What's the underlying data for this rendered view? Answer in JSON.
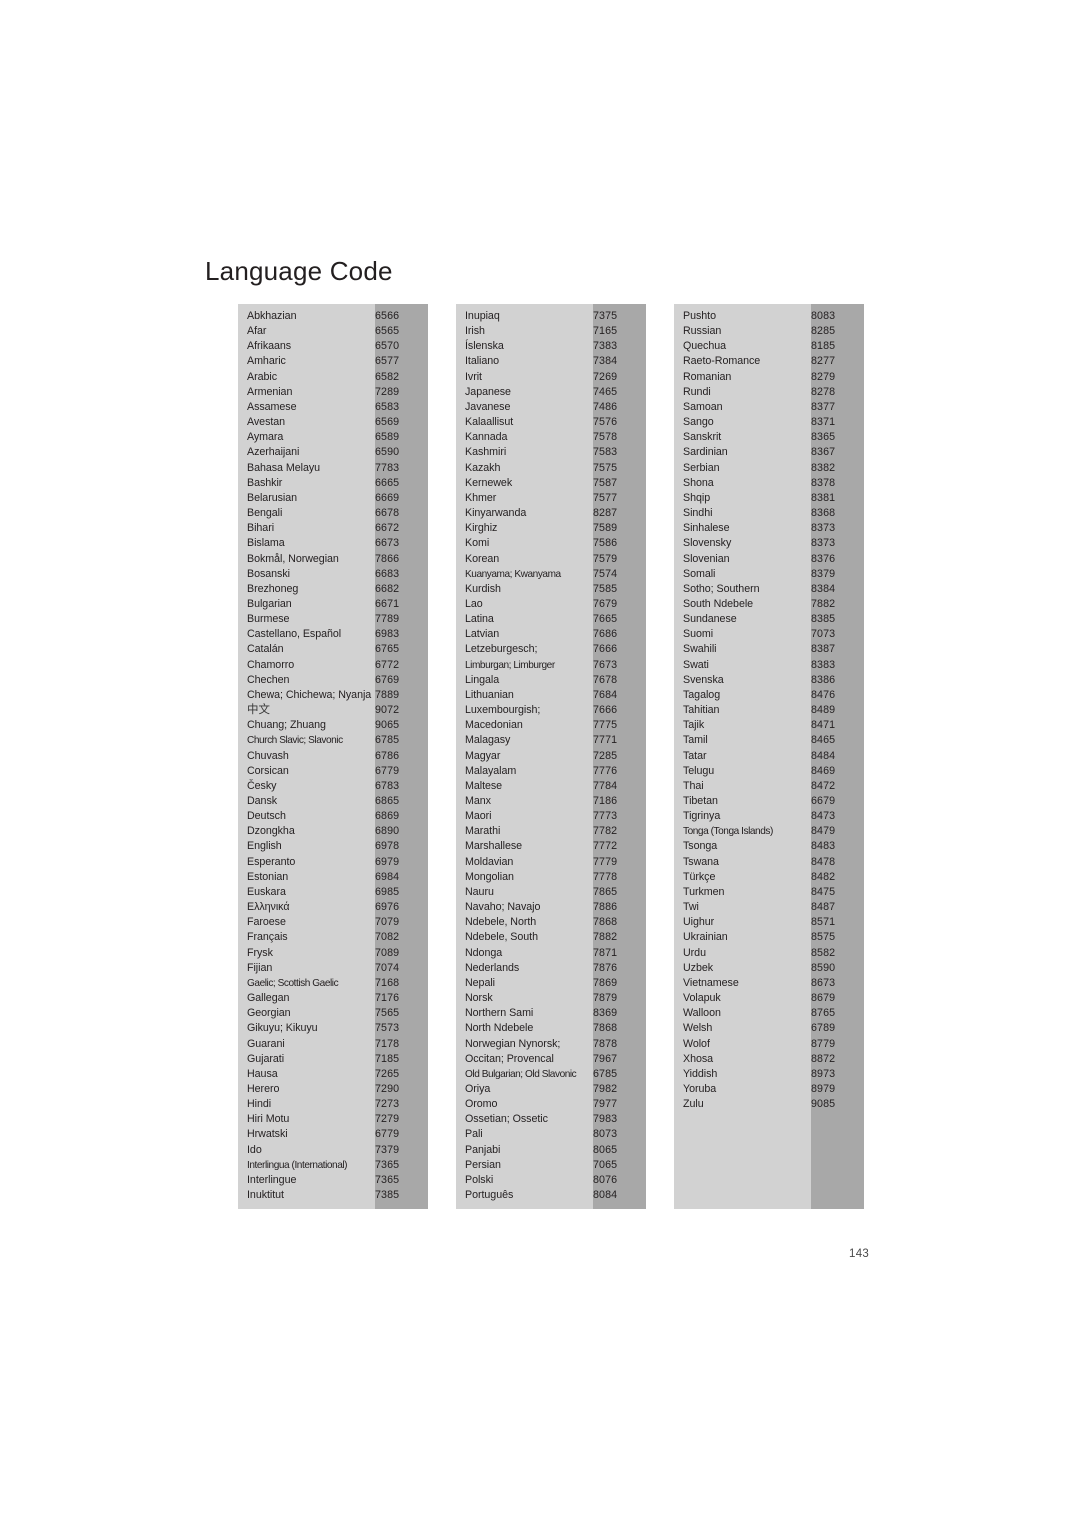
{
  "page": {
    "title": "Language Code",
    "page_number": "143",
    "colors": {
      "name_column_bg": "#d2d2d2",
      "code_column_bg": "#a8a8a8",
      "text": "#231f20",
      "page_bg": "#ffffff"
    }
  },
  "columns": [
    {
      "id": "column-1",
      "rows": [
        {
          "language": "Abkhazian",
          "code": "6566"
        },
        {
          "language": "Afar",
          "code": "6565"
        },
        {
          "language": "Afrikaans",
          "code": "6570"
        },
        {
          "language": "Amharic",
          "code": "6577"
        },
        {
          "language": "Arabic",
          "code": "6582"
        },
        {
          "language": "Armenian",
          "code": "7289"
        },
        {
          "language": "Assamese",
          "code": "6583"
        },
        {
          "language": "Avestan",
          "code": "6569"
        },
        {
          "language": "Aymara",
          "code": "6589"
        },
        {
          "language": "Azerhaijani",
          "code": "6590"
        },
        {
          "language": "Bahasa Melayu",
          "code": "7783"
        },
        {
          "language": "Bashkir",
          "code": "6665"
        },
        {
          "language": "Belarusian",
          "code": "6669"
        },
        {
          "language": "Bengali",
          "code": "6678"
        },
        {
          "language": "Bihari",
          "code": "6672"
        },
        {
          "language": "Bislama",
          "code": "6673"
        },
        {
          "language": "Bokmål, Norwegian",
          "code": "7866"
        },
        {
          "language": "Bosanski",
          "code": "6683"
        },
        {
          "language": "Brezhoneg",
          "code": "6682"
        },
        {
          "language": "Bulgarian",
          "code": "6671"
        },
        {
          "language": "Burmese",
          "code": "7789"
        },
        {
          "language": "Castellano, Español",
          "code": "6983"
        },
        {
          "language": "Catalán",
          "code": "6765"
        },
        {
          "language": "Chamorro",
          "code": "6772"
        },
        {
          "language": "Chechen",
          "code": "6769"
        },
        {
          "language": "Chewa; Chichewa; Nyanja",
          "code": "7889",
          "style": "overflow"
        },
        {
          "language": "中文",
          "code": "9072",
          "style": "cjk"
        },
        {
          "language": "Chuang; Zhuang",
          "code": "9065"
        },
        {
          "language": "Church Slavic; Slavonic",
          "code": "6785",
          "style": "squeeze"
        },
        {
          "language": "Chuvash",
          "code": "6786"
        },
        {
          "language": "Corsican",
          "code": "6779"
        },
        {
          "language": "Česky",
          "code": "6783"
        },
        {
          "language": "Dansk",
          "code": "6865"
        },
        {
          "language": "Deutsch",
          "code": "6869"
        },
        {
          "language": "Dzongkha",
          "code": "6890"
        },
        {
          "language": "English",
          "code": "6978"
        },
        {
          "language": "Esperanto",
          "code": "6979"
        },
        {
          "language": "Estonian",
          "code": "6984"
        },
        {
          "language": "Euskara",
          "code": "6985"
        },
        {
          "language": "Ελληνικά",
          "code": "6976"
        },
        {
          "language": "Faroese",
          "code": "7079"
        },
        {
          "language": "Français",
          "code": "7082"
        },
        {
          "language": "Frysk",
          "code": "7089"
        },
        {
          "language": "Fijian",
          "code": "7074"
        },
        {
          "language": "Gaelic; Scottish Gaelic",
          "code": "7168",
          "style": "squeeze"
        },
        {
          "language": "Gallegan",
          "code": "7176"
        },
        {
          "language": "Georgian",
          "code": "7565"
        },
        {
          "language": "Gikuyu; Kikuyu",
          "code": "7573"
        },
        {
          "language": "Guarani",
          "code": "7178"
        },
        {
          "language": "Gujarati",
          "code": "7185"
        },
        {
          "language": "Hausa",
          "code": "7265"
        },
        {
          "language": "Herero",
          "code": "7290"
        },
        {
          "language": "Hindi",
          "code": "7273"
        },
        {
          "language": "Hiri Motu",
          "code": "7279"
        },
        {
          "language": "Hrwatski",
          "code": "6779"
        },
        {
          "language": "Ido",
          "code": "7379"
        },
        {
          "language": "Interlingua (International)",
          "code": "7365",
          "style": "overflow squeeze"
        },
        {
          "language": "Interlingue",
          "code": "7365"
        },
        {
          "language": "Inuktitut",
          "code": "7385"
        }
      ]
    },
    {
      "id": "column-2",
      "rows": [
        {
          "language": "Inupiaq",
          "code": "7375"
        },
        {
          "language": "Irish",
          "code": "7165"
        },
        {
          "language": "Íslenska",
          "code": "7383"
        },
        {
          "language": "Italiano",
          "code": "7384"
        },
        {
          "language": "Ivrit",
          "code": "7269"
        },
        {
          "language": "Japanese",
          "code": "7465"
        },
        {
          "language": "Javanese",
          "code": "7486"
        },
        {
          "language": "Kalaallisut",
          "code": "7576"
        },
        {
          "language": "Kannada",
          "code": "7578"
        },
        {
          "language": "Kashmiri",
          "code": "7583"
        },
        {
          "language": "Kazakh",
          "code": "7575"
        },
        {
          "language": "Kernewek",
          "code": "7587"
        },
        {
          "language": "Khmer",
          "code": "7577"
        },
        {
          "language": "Kinyarwanda",
          "code": "8287"
        },
        {
          "language": "Kirghiz",
          "code": "7589"
        },
        {
          "language": "Komi",
          "code": "7586"
        },
        {
          "language": "Korean",
          "code": "7579"
        },
        {
          "language": "Kuanyama; Kwanyama",
          "code": "7574",
          "style": "squeeze"
        },
        {
          "language": "Kurdish",
          "code": "7585"
        },
        {
          "language": "Lao",
          "code": "7679"
        },
        {
          "language": "Latina",
          "code": "7665"
        },
        {
          "language": "Latvian",
          "code": "7686"
        },
        {
          "language": "Letzeburgesch;",
          "code": "7666"
        },
        {
          "language": "Limburgan; Limburger",
          "code": "7673",
          "style": "squeeze"
        },
        {
          "language": "Lingala",
          "code": "7678"
        },
        {
          "language": "Lithuanian",
          "code": "7684"
        },
        {
          "language": "Luxembourgish;",
          "code": "7666"
        },
        {
          "language": "Macedonian",
          "code": "7775"
        },
        {
          "language": "Malagasy",
          "code": "7771"
        },
        {
          "language": "Magyar",
          "code": "7285"
        },
        {
          "language": "Malayalam",
          "code": "7776"
        },
        {
          "language": "Maltese",
          "code": "7784"
        },
        {
          "language": "Manx",
          "code": "7186"
        },
        {
          "language": "Maori",
          "code": "7773"
        },
        {
          "language": "Marathi",
          "code": "7782"
        },
        {
          "language": "Marshallese",
          "code": "7772"
        },
        {
          "language": "Moldavian",
          "code": "7779"
        },
        {
          "language": "Mongolian",
          "code": "7778"
        },
        {
          "language": "Nauru",
          "code": "7865"
        },
        {
          "language": "Navaho; Navajo",
          "code": "7886"
        },
        {
          "language": "Ndebele, North",
          "code": "7868"
        },
        {
          "language": "Ndebele, South",
          "code": "7882"
        },
        {
          "language": "Ndonga",
          "code": "7871"
        },
        {
          "language": "Nederlands",
          "code": "7876"
        },
        {
          "language": "Nepali",
          "code": "7869"
        },
        {
          "language": "Norsk",
          "code": "7879"
        },
        {
          "language": "Northern Sami",
          "code": "8369"
        },
        {
          "language": "North Ndebele",
          "code": "7868"
        },
        {
          "language": "Norwegian Nynorsk;",
          "code": "7878"
        },
        {
          "language": "Occitan; Provencal",
          "code": "7967"
        },
        {
          "language": "Old Bulgarian; Old Slavonic",
          "code": "6785",
          "style": "squeeze"
        },
        {
          "language": "Oriya",
          "code": "7982"
        },
        {
          "language": "Oromo",
          "code": "7977"
        },
        {
          "language": "Ossetian; Ossetic",
          "code": "7983"
        },
        {
          "language": "Pali",
          "code": "8073"
        },
        {
          "language": "Panjabi",
          "code": "8065"
        },
        {
          "language": "Persian",
          "code": "7065"
        },
        {
          "language": "Polski",
          "code": "8076"
        },
        {
          "language": "Português",
          "code": "8084"
        }
      ]
    },
    {
      "id": "column-3",
      "rows": [
        {
          "language": "Pushto",
          "code": "8083"
        },
        {
          "language": "Russian",
          "code": "8285"
        },
        {
          "language": "Quechua",
          "code": "8185"
        },
        {
          "language": "Raeto-Romance",
          "code": "8277"
        },
        {
          "language": "Romanian",
          "code": "8279"
        },
        {
          "language": "Rundi",
          "code": "8278"
        },
        {
          "language": "Samoan",
          "code": "8377"
        },
        {
          "language": "Sango",
          "code": "8371"
        },
        {
          "language": "Sanskrit",
          "code": "8365"
        },
        {
          "language": "Sardinian",
          "code": "8367"
        },
        {
          "language": "Serbian",
          "code": "8382"
        },
        {
          "language": "Shona",
          "code": "8378"
        },
        {
          "language": "Shqip",
          "code": "8381"
        },
        {
          "language": "Sindhi",
          "code": "8368"
        },
        {
          "language": "Sinhalese",
          "code": "8373"
        },
        {
          "language": "Slovensky",
          "code": "8373"
        },
        {
          "language": "Slovenian",
          "code": "8376"
        },
        {
          "language": "Somali",
          "code": "8379"
        },
        {
          "language": "Sotho; Southern",
          "code": "8384"
        },
        {
          "language": "South Ndebele",
          "code": "7882"
        },
        {
          "language": "Sundanese",
          "code": "8385"
        },
        {
          "language": "Suomi",
          "code": "7073"
        },
        {
          "language": "Swahili",
          "code": "8387"
        },
        {
          "language": "Swati",
          "code": "8383"
        },
        {
          "language": "Svenska",
          "code": "8386"
        },
        {
          "language": "Tagalog",
          "code": "8476"
        },
        {
          "language": "Tahitian",
          "code": "8489"
        },
        {
          "language": "Tajik",
          "code": "8471"
        },
        {
          "language": "Tamil",
          "code": "8465"
        },
        {
          "language": "Tatar",
          "code": "8484"
        },
        {
          "language": "Telugu",
          "code": "8469"
        },
        {
          "language": "Thai",
          "code": "8472"
        },
        {
          "language": "Tibetan",
          "code": "6679"
        },
        {
          "language": "Tigrinya",
          "code": "8473"
        },
        {
          "language": "Tonga (Tonga Islands)",
          "code": "8479",
          "style": "squeeze"
        },
        {
          "language": "Tsonga",
          "code": "8483"
        },
        {
          "language": "Tswana",
          "code": "8478"
        },
        {
          "language": "Türkçe",
          "code": "8482"
        },
        {
          "language": "Turkmen",
          "code": "8475"
        },
        {
          "language": "Twi",
          "code": "8487"
        },
        {
          "language": "Uighur",
          "code": "8571"
        },
        {
          "language": "Ukrainian",
          "code": "8575"
        },
        {
          "language": "Urdu",
          "code": "8582"
        },
        {
          "language": "Uzbek",
          "code": "8590"
        },
        {
          "language": "Vietnamese",
          "code": "8673"
        },
        {
          "language": "Volapuk",
          "code": "8679"
        },
        {
          "language": "Walloon",
          "code": "8765"
        },
        {
          "language": "Welsh",
          "code": "6789"
        },
        {
          "language": "Wolof",
          "code": "8779"
        },
        {
          "language": "Xhosa",
          "code": "8872"
        },
        {
          "language": "Yiddish",
          "code": "8973"
        },
        {
          "language": "Yoruba",
          "code": "8979"
        },
        {
          "language": "Zulu",
          "code": "9085"
        }
      ],
      "trailing_blank_rows": 6
    }
  ]
}
